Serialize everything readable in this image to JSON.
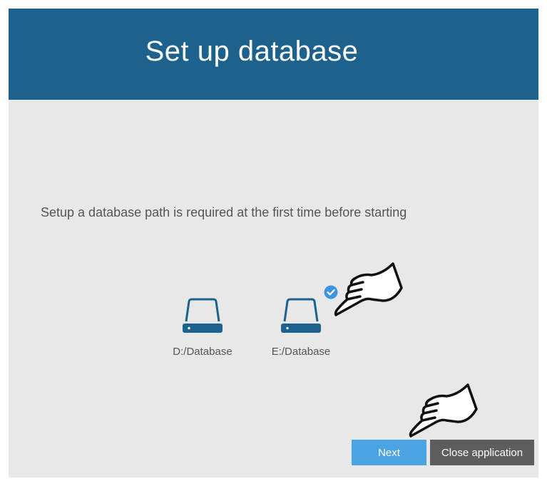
{
  "header": {
    "title": "Set up database"
  },
  "main": {
    "instruction": "Setup a database path is required at the first time before starting",
    "drives": [
      {
        "label": "D:/Database",
        "icon": "drive-icon",
        "selected": false
      },
      {
        "label": "E:/Database",
        "icon": "drive-icon",
        "selected": true
      }
    ]
  },
  "footer": {
    "next_label": "Next",
    "close_label": "Close application"
  },
  "colors": {
    "header_bg": "#1c628d",
    "body_bg": "#e8e8e8",
    "accent": "#4aa3e2",
    "drive_icon": "#1c628d",
    "close_button_bg": "#5d5d5d"
  }
}
